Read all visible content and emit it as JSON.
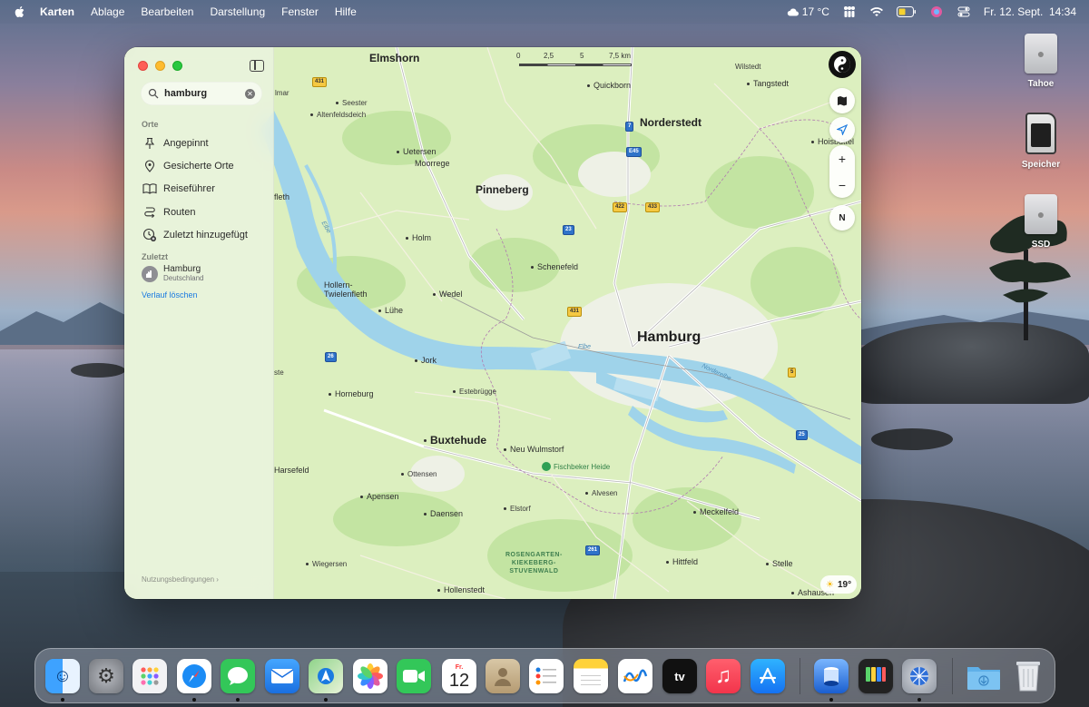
{
  "menubar": {
    "app_name": "Karten",
    "menus": [
      "Ablage",
      "Bearbeiten",
      "Darstellung",
      "Fenster",
      "Hilfe"
    ],
    "weather": "17 °C",
    "datetime": "Fr. 12. Sept.  14:34",
    "icons": [
      "apple-icon",
      "weather-cloud-icon",
      "family-icon",
      "wifi-icon",
      "battery-icon",
      "siri-icon",
      "control-center-icon"
    ]
  },
  "desktop": {
    "items": [
      {
        "label": "Tahoe",
        "icon": "disk-icon"
      },
      {
        "label": "Speicher",
        "icon": "sd-card-icon"
      },
      {
        "label": "SSD",
        "icon": "disk-icon"
      }
    ]
  },
  "sidebar": {
    "search": {
      "value": "hamburg",
      "placeholder": "Suchen"
    },
    "places_head": "Orte",
    "items": [
      {
        "label": "Angepinnt",
        "icon": "pin-icon"
      },
      {
        "label": "Gesicherte Orte",
        "icon": "location-pin-icon"
      },
      {
        "label": "Reiseführer",
        "icon": "book-icon"
      },
      {
        "label": "Routen",
        "icon": "routes-icon"
      },
      {
        "label": "Zuletzt hinzugefügt",
        "icon": "clock-add-icon"
      }
    ],
    "recent_head": "Zuletzt",
    "recent": {
      "title": "Hamburg",
      "subtitle": "Deutschland"
    },
    "clear_history": "Verlauf löschen",
    "terms": "Nutzungsbedingungen"
  },
  "map": {
    "scale": [
      "0",
      "2,5",
      "5",
      "7,5 km"
    ],
    "weather_badge": "19°",
    "compass": "N",
    "labels": {
      "hamburg": "Hamburg",
      "norderstedt": "Norderstedt",
      "pinneberg": "Pinneberg",
      "elmshorn": "Elmshorn",
      "buxtehude": "Buxtehude",
      "quickborn": "Quickborn",
      "tangstedt": "Tangstedt",
      "wilstedt": "Wilstedt",
      "hoisbuettel": "Hoisbüttel",
      "uetersen": "Uetersen",
      "moorrege": "Moorrege",
      "seester": "Seester",
      "altenfeldsdeich": "Altenfeldsdeich",
      "holm": "Holm",
      "schenefeld": "Schenefeld",
      "hollern": "Hollern-\nTwielenfleth",
      "wedel": "Wedel",
      "luehe": "Lühe",
      "jork": "Jork",
      "horneburg": "Horneburg",
      "estebruegge": "Estebrügge",
      "neu_wulmstorf": "Neu Wulmstorf",
      "fischbeker": "Fischbeker Heide",
      "ottensen": "Ottensen",
      "alvesen": "Alvesen",
      "apensen": "Apensen",
      "daensen": "Daensen",
      "elstorf": "Elstorf",
      "meckelfeld": "Meckelfeld",
      "harsefeld": "Harsefeld",
      "forest": "ROSENGARTEN-\nKIEKEBERG-\nSTUVENWALD",
      "wiegersen": "Wiegersen",
      "hittfeld": "Hittfeld",
      "stelle": "Stelle",
      "hollenstedt": "Hollenstedt",
      "ashausen": "Ashausen",
      "elbe": "Elbe",
      "elbe2": "Elbe",
      "norderelbe": "Norderelbe",
      "mar": "lmar",
      "fleth": "fleth",
      "ste": "ste"
    },
    "shields": [
      "431",
      "7",
      "E45",
      "422",
      "433",
      "23",
      "431",
      "26",
      "5",
      "25",
      "261"
    ]
  },
  "dock": {
    "apps": [
      "Finder",
      "Systemeinstellungen",
      "Apps",
      "Safari",
      "Nachrichten",
      "Mail",
      "Karten",
      "Fotos",
      "FaceTime",
      "Kalender",
      "Kontakte",
      "Erinnerungen",
      "Notizen",
      "Freeform",
      "TV",
      "Musik",
      "App Store",
      "Vorschau",
      "Bildschirmfoto",
      "Netzwerk",
      "Downloads",
      "Papierkorb"
    ],
    "calendar_month": "Fr.",
    "calendar_day": "12",
    "tv_label": "tv"
  }
}
